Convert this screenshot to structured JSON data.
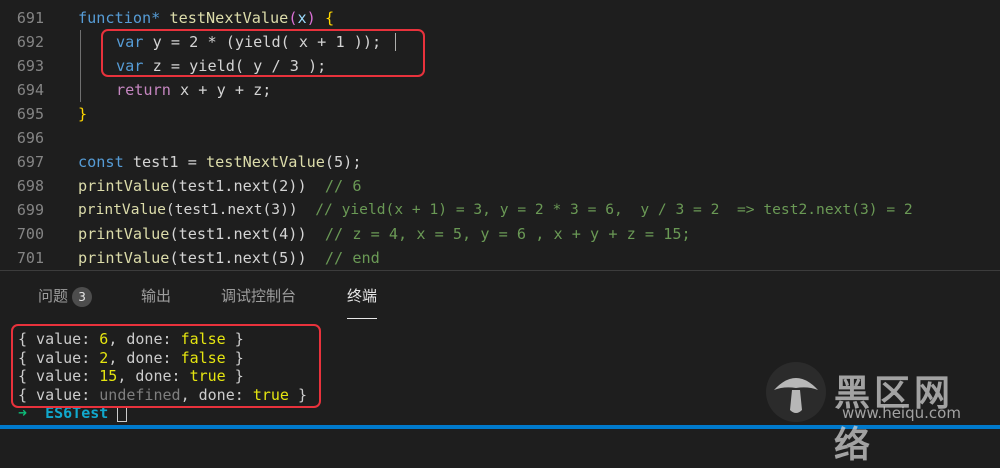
{
  "editor": {
    "line_numbers": [
      "691",
      "692",
      "693",
      "694",
      "695",
      "696",
      "697",
      "698",
      "699",
      "700",
      "701"
    ],
    "lines": {
      "l691": {
        "kw": "function*",
        "fn": "testNextValue",
        "open": "(",
        "param": "x",
        "close": ")",
        "brace": "{"
      },
      "l692": {
        "kw": "var",
        "rest": " y = 2 * (yield( x + 1 ));"
      },
      "l693": {
        "kw": "var",
        "rest": " z = yield( y / 3 );"
      },
      "l694": {
        "kw": "return",
        "rest": " x + y + z;"
      },
      "l695": {
        "brace": "}"
      },
      "l697": {
        "kw": "const",
        "rest": " test1 = ",
        "fn": "testNextValue",
        "args": "(5);"
      },
      "l698": {
        "fn": "printValue",
        "call": "(test1.next(2))",
        "comment": "// 6"
      },
      "l699": {
        "fn": "printValue",
        "call": "(test1.next(3))",
        "comment": "// yield(x + 1) = 3, y = 2 * 3 = 6,  y / 3 = 2  => test2.next(3) = 2"
      },
      "l700": {
        "fn": "printValue",
        "call": "(test1.next(4))",
        "comment": "// z = 4, x = 5, y = 6 , x + y + z = 15;"
      },
      "l701": {
        "fn": "printValue",
        "call": "(test1.next(5))",
        "comment": "// end"
      }
    }
  },
  "panel": {
    "tabs": [
      {
        "label": "问题",
        "badge": "3"
      },
      {
        "label": "输出"
      },
      {
        "label": "调试控制台"
      },
      {
        "label": "终端"
      }
    ],
    "active_tab": "终端"
  },
  "terminal": {
    "outputs": [
      {
        "value": "6",
        "done": "false"
      },
      {
        "value": "2",
        "done": "false"
      },
      {
        "value": "15",
        "done": "true"
      },
      {
        "value": "undefined",
        "done": "true"
      }
    ],
    "prompt_arrow": "➜",
    "prompt_dir": "ES6Test"
  },
  "watermark": {
    "text": "黑区网络",
    "url": "www.heiqu.com"
  },
  "colors": {
    "highlight_box": "#e8323c",
    "accent": "#007acc",
    "background": "#1e1e1e"
  }
}
